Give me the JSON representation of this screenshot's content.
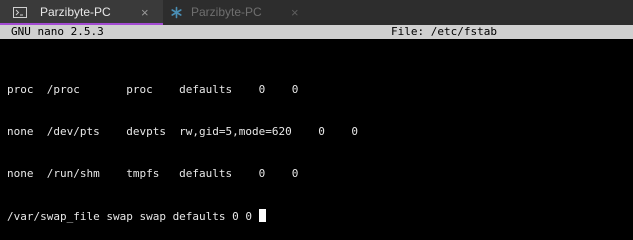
{
  "tabs": [
    {
      "label": "Parzibyte-PC",
      "icon": "terminal-icon",
      "close": "×",
      "active": true
    },
    {
      "label": "Parzibyte-PC",
      "icon": "asterisk-icon",
      "close": "×",
      "active": false
    }
  ],
  "nano": {
    "app_name": "GNU nano 2.5.3",
    "file_label": "File: /etc/fstab"
  },
  "editor": {
    "lines": [
      "",
      "proc  /proc       proc    defaults    0    0",
      "none  /dev/pts    devpts  rw,gid=5,mode=620    0    0",
      "none  /run/shm    tmpfs   defaults    0    0",
      "/var/swap_file swap swap defaults 0 0"
    ]
  },
  "colors": {
    "accent": "#a34bd3",
    "terminal_bg": "#000000",
    "terminal_fg": "#e8e8e8",
    "titlebar_bg": "#d0d0d0"
  }
}
